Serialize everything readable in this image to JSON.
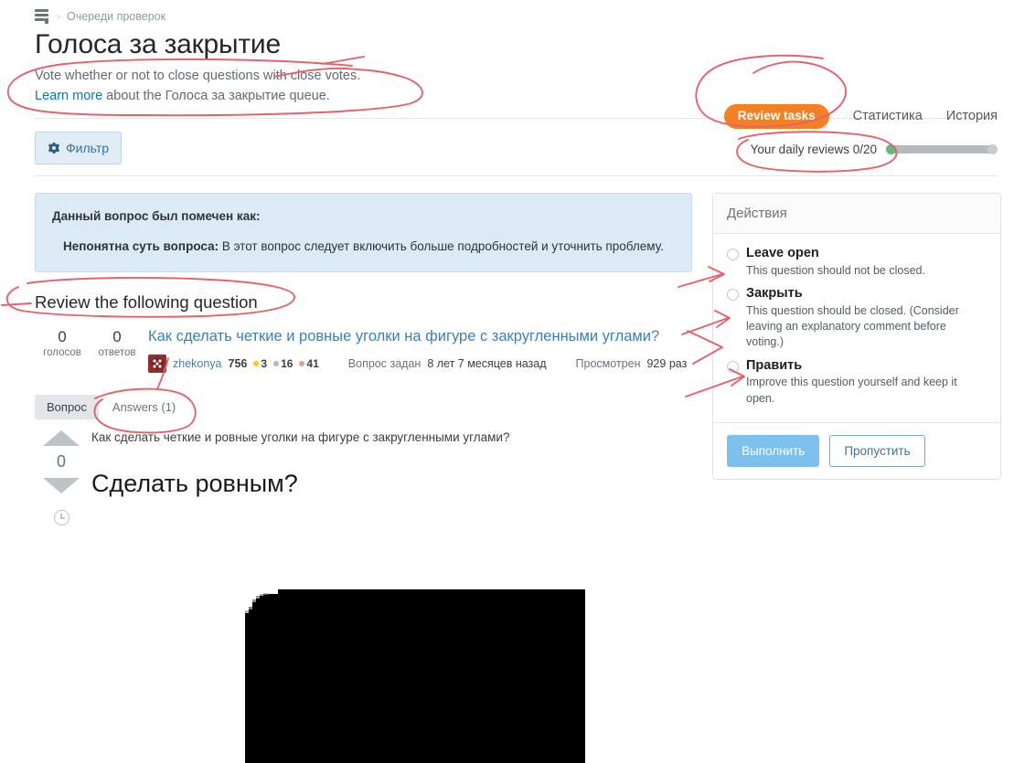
{
  "breadcrumb": {
    "icon": "stacks-icon",
    "separator": "›",
    "label": "Очереди проверок"
  },
  "header": {
    "title": "Голоса за закрытие",
    "subtitle_line1": "Vote whether or not to close questions with close votes.",
    "learn_more": "Learn more",
    "subtitle_line2_rest": " about the Голоса за закрытие queue."
  },
  "top_nav": {
    "active_tab": "Review tasks",
    "links": [
      "Статистика",
      "История"
    ],
    "accent_color": "#f48024"
  },
  "toolbar": {
    "filter_label": "Фильтр",
    "daily_reviews_label": "Your daily reviews 0/20",
    "progress_value": 0,
    "progress_max": 20,
    "progress_dot_color": "#5eba7d"
  },
  "notice": {
    "heading": "Данный вопрос был помечен как:",
    "reason_title": "Непонятна суть вопроса:",
    "reason_text": " В этот вопрос следует включить больше подробностей и уточнить проблему."
  },
  "review": {
    "heading": "Review the following question",
    "votes_count": "0",
    "votes_label": "голосов",
    "answers_count": "0",
    "answers_label": "ответов",
    "question_title": "Как сделать четкие и ровные уголки на фигуре с закругленными углами?",
    "author": "zhekonya",
    "reputation": "756",
    "badges": {
      "gold": "3",
      "silver": "16",
      "bronze": "41"
    },
    "asked_label": "Вопрос задан",
    "asked_time": "8 лет 7 месяцев назад",
    "views_label": "Просмотрен",
    "views_value": "929 раз"
  },
  "post_tabs": {
    "question_tab": "Вопрос",
    "answers_tab": "Answers (1)"
  },
  "answer": {
    "quoted_question": "Как сделать четкие и ровные уголки на фигуре с закругленными углами?",
    "heading": "Сделать ровным?",
    "vote_score": "0",
    "image_alt": "black-rounded-corner-image"
  },
  "actions": {
    "title": "Действия",
    "options": [
      {
        "label": "Leave open",
        "description": "This question should not be closed."
      },
      {
        "label": "Закрыть",
        "description": "This question should be closed. (Consider leaving an explanatory comment before voting.)"
      },
      {
        "label": "Править",
        "description": "Improve this question yourself and keep it open."
      }
    ],
    "submit_label": "Выполнить",
    "skip_label": "Пропустить"
  },
  "annotation_color": "#e8616a"
}
